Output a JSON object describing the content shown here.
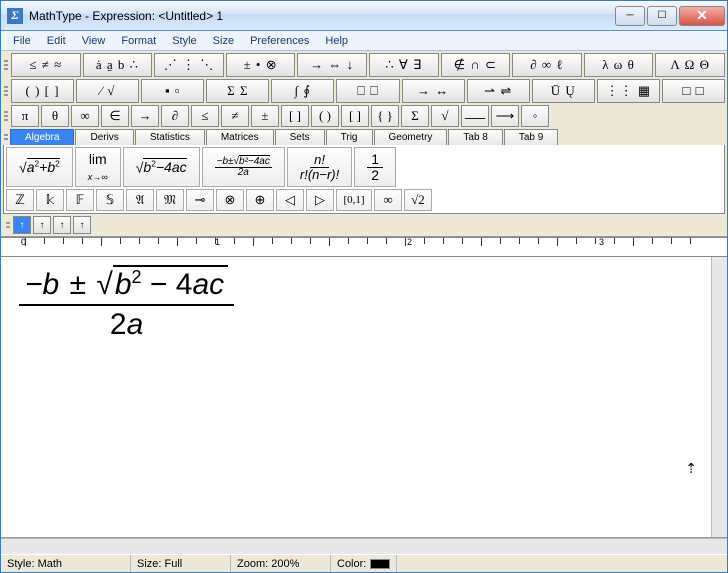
{
  "title": "MathType - Expression: <Untitled> 1",
  "menu": [
    "File",
    "Edit",
    "View",
    "Format",
    "Style",
    "Size",
    "Preferences",
    "Help"
  ],
  "palette_row1": [
    "≤ ≠ ≈",
    "ȧ a̱ b ∴",
    "⋰ ⋮ ⋱",
    "± • ⊗",
    "→ ⇔ ↓",
    "∴ ∀ ∃",
    "∉ ∩ ⊂",
    "∂ ∞ ℓ",
    "λ ω θ",
    "Λ Ω Θ"
  ],
  "palette_row2": [
    "( ) [ ]",
    "⁄ √",
    "▪ ▫",
    "Σ Σ",
    "∫ ∮",
    "⎕ ⎕",
    "→ ↔",
    "⇀ ⇌",
    "Ū Ų",
    "⋮⋮ ▦",
    "□ □"
  ],
  "sym_row": [
    "π",
    "θ",
    "∞",
    "∈",
    "→",
    "∂",
    "≤",
    "≠",
    "±",
    "[ ]",
    "( )",
    "[ ]",
    "{ }",
    "Σ",
    "√",
    "⸺",
    "⟶",
    "◦"
  ],
  "tabs": [
    "Algebra",
    "Derivs",
    "Statistics",
    "Matrices",
    "Sets",
    "Trig",
    "Geometry",
    "Tab 8",
    "Tab 9"
  ],
  "tray_main": [
    "√(a²+b²)",
    "lim x→∞",
    "√(b²−4ac)",
    "−b±√(b²−4ac)/2a",
    "n! / r!(n−r)!",
    "1/2"
  ],
  "tray_small": [
    "ℤ",
    "𝕜",
    "𝔽",
    "𝕊",
    "𝔄",
    "𝔐",
    "⊸",
    "⊗",
    "⊕",
    "◁",
    "▷",
    "[0,1]",
    "∞",
    "√2"
  ],
  "arrows": [
    "↑",
    "↑",
    "↑",
    "↑"
  ],
  "ruler_nums": [
    "0",
    "1",
    "2",
    "3"
  ],
  "expr": {
    "neg": "−",
    "b": "b",
    "pm": "±",
    "var": "b",
    "sq": "2",
    "minus": "−",
    "coef": "4",
    "a": "a",
    "c": "c",
    "den_coef": "2",
    "den_var": "a"
  },
  "status": {
    "style_lbl": "Style:",
    "style": "Math",
    "size_lbl": "Size:",
    "size": "Full",
    "zoom_lbl": "Zoom:",
    "zoom": "200%",
    "color_lbl": "Color:"
  }
}
